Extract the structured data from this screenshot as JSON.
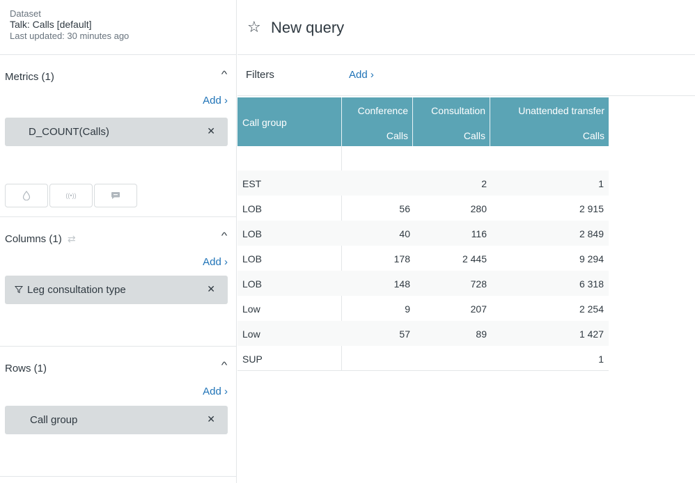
{
  "dataset": {
    "caption": "Dataset",
    "name": "Talk: Calls [default]",
    "updated": "Last updated: 30 minutes ago"
  },
  "metrics": {
    "title": "Metrics (1)",
    "add": "Add ›",
    "chip": "D_COUNT(Calls)"
  },
  "columns": {
    "title": "Columns (1)",
    "add": "Add ›",
    "chip": "Leg consultation type"
  },
  "rows": {
    "title": "Rows (1)",
    "add": "Add ›",
    "chip": "Call group"
  },
  "query": {
    "title": "New query"
  },
  "filters": {
    "label": "Filters",
    "add": "Add ›"
  },
  "table": {
    "header_first": "Call group",
    "headers": [
      {
        "top": "Conference",
        "bottom": "Calls"
      },
      {
        "top": "Consultation",
        "bottom": "Calls"
      },
      {
        "top": "Unattended transfer",
        "bottom": "Calls"
      }
    ],
    "rows": [
      {
        "label": "EST",
        "values": [
          "",
          "2",
          "1"
        ]
      },
      {
        "label": "LOB",
        "values": [
          "56",
          "280",
          "2 915"
        ]
      },
      {
        "label": "LOB",
        "values": [
          "40",
          "116",
          "2 849"
        ]
      },
      {
        "label": "LOB",
        "values": [
          "178",
          "2 445",
          "9 294"
        ]
      },
      {
        "label": "LOB",
        "values": [
          "148",
          "728",
          "6 318"
        ]
      },
      {
        "label": "Low",
        "values": [
          "9",
          "207",
          "2 254"
        ]
      },
      {
        "label": "Low",
        "values": [
          "57",
          "89",
          "1 427"
        ]
      },
      {
        "label": "SUP",
        "values": [
          "",
          "",
          "1"
        ]
      }
    ]
  },
  "colors": {
    "accent": "#1f73b7",
    "table_header": "#5ba4b5",
    "chip": "#d8dcde"
  }
}
